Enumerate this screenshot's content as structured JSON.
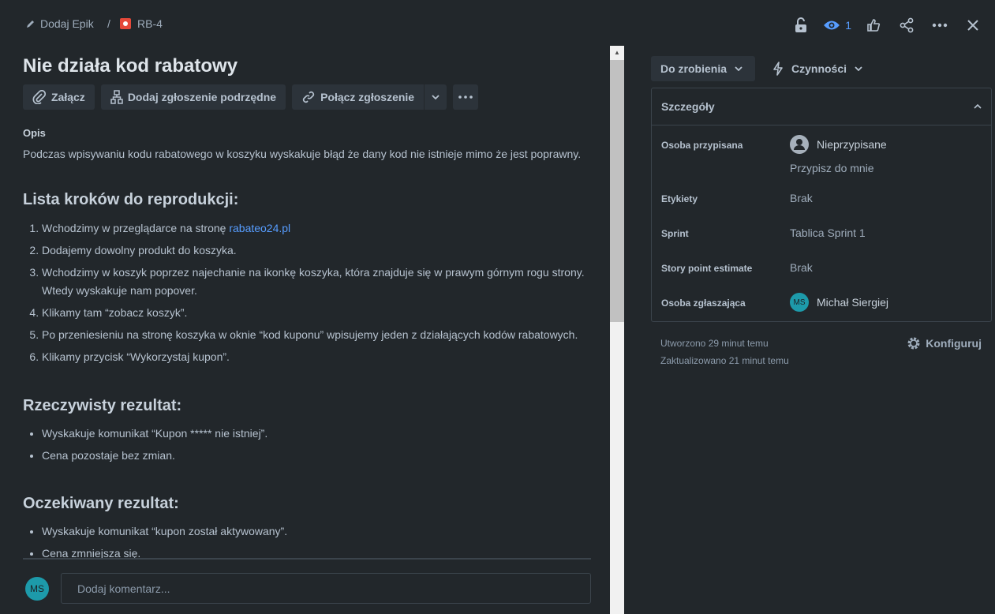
{
  "breadcrumb": {
    "add_epic": "Dodaj Epik",
    "separator": "/",
    "issue_key": "RB-4"
  },
  "top_icons": {
    "watch_count": "1"
  },
  "issue": {
    "title": "Nie działa kod rabatowy",
    "buttons": {
      "attach": "Załącz",
      "add_child": "Dodaj zgłoszenie podrzędne",
      "link": "Połącz zgłoszenie"
    },
    "description_label": "Opis",
    "description": "Podczas wpisywaniu kodu rabatowego w koszyku wyskakuje błąd że dany kod nie istnieje mimo że jest poprawny.",
    "steps_heading": "Lista kroków do reprodukcji:",
    "step1_text": "Wchodzimy w przeglądarce na stronę ",
    "step1_link": "rabateo24.pl",
    "steps": [
      "Dodajemy dowolny produkt do koszyka.",
      "Wchodzimy w koszyk poprzez najechanie na ikonkę koszyka, która znajduje się w prawym górnym rogu strony. Wtedy wyskakuje nam popover.",
      "Klikamy tam “zobacz koszyk”.",
      "Po przeniesieniu na stronę koszyka w oknie “kod kuponu” wpisujemy jeden z działających kodów rabatowych.",
      "Klikamy przycisk “Wykorzystaj kupon”."
    ],
    "actual_heading": "Rzeczywisty rezultat:",
    "actual": [
      "Wyskakuje komunikat “Kupon ***** nie istniej”.",
      "Cena pozostaje bez zmian."
    ],
    "expected_heading": "Oczekiwany rezultat:",
    "expected": [
      "Wyskakuje komunikat “kupon został aktywowany”.",
      "Cena zmniejsza się."
    ]
  },
  "comment": {
    "avatar": "MS",
    "placeholder": "Dodaj komentarz..."
  },
  "sidebar": {
    "status": "Do zrobienia",
    "actions": "Czynności",
    "details_heading": "Szczegóły",
    "fields": {
      "assignee_label": "Osoba przypisana",
      "assignee_value": "Nieprzypisane",
      "assign_to_me": "Przypisz do mnie",
      "labels_label": "Etykiety",
      "labels_value": "Brak",
      "sprint_label": "Sprint",
      "sprint_value": "Tablica Sprint 1",
      "sp_label": "Story point estimate",
      "sp_value": "Brak",
      "reporter_label": "Osoba zgłaszająca",
      "reporter_avatar": "MS",
      "reporter_value": "Michał Siergiej"
    },
    "created": "Utworzono 29 minut temu",
    "updated": "Zaktualizowano 21 minut temu",
    "configure": "Konfiguruj"
  },
  "colors": {
    "background": "#22272b",
    "link": "#579dff",
    "avatar": "#1d9aaa",
    "issue_type": "#e5493a"
  }
}
